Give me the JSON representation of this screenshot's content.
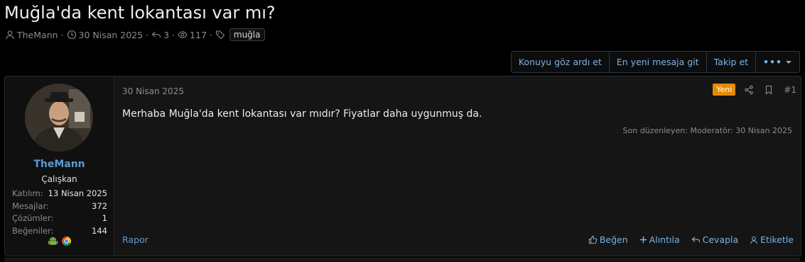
{
  "thread": {
    "title": "Muğla'da kent lokantası var mı?",
    "author": "TheMann",
    "date": "30 Nisan 2025",
    "replies": "3",
    "views": "117",
    "tag": "muğla"
  },
  "toolbar": {
    "ignore_label": "Konuyu göz ardı et",
    "newest_label": "En yeni mesaja git",
    "follow_label": "Takip et",
    "more_label": "•••"
  },
  "user": {
    "name": "TheMann",
    "title": "Çalışkan",
    "stats": [
      {
        "label": "Katılım:",
        "value": "13 Nisan 2025"
      },
      {
        "label": "Mesajlar:",
        "value": "372"
      },
      {
        "label": "Çözümler:",
        "value": "1"
      },
      {
        "label": "Beğeniler:",
        "value": "144"
      }
    ]
  },
  "post": {
    "date": "30 Nisan 2025",
    "badge": "Yeni",
    "number": "#1",
    "body": "Merhaba Muğla'da kent lokantası var mıdır? Fiyatlar daha uygunmuş da.",
    "edited": "Son düzenleyen: Moderatör: 30 Nisan 2025",
    "report_label": "Rapor",
    "actions": {
      "like": "Beğen",
      "quote": "Alıntıla",
      "reply": "Cevapla",
      "tag": "Etiketle"
    }
  },
  "colors": {
    "accent": "#5b9bd5",
    "new_badge": "#e68a00",
    "background": "#000000",
    "panel": "#151515"
  }
}
